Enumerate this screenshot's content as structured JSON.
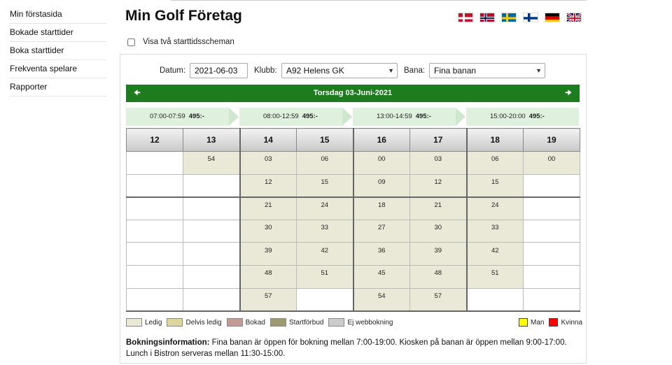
{
  "sidebar": {
    "items": [
      {
        "label": "Min förstasida"
      },
      {
        "label": "Bokade starttider"
      },
      {
        "label": "Boka starttider"
      },
      {
        "label": "Frekventa spelare"
      },
      {
        "label": "Rapporter"
      }
    ]
  },
  "header": {
    "title": "Min Golf Företag",
    "flags": [
      "danish-flag",
      "norwegian-flag",
      "swedish-flag",
      "finnish-flag",
      "german-flag",
      "uk-flag"
    ]
  },
  "options": {
    "show_two_schedules_label": "Visa två starttidsscheman",
    "show_two_schedules_checked": false
  },
  "filters": {
    "date_label": "Datum:",
    "date_value": "2021-06-03",
    "club_label": "Klubb:",
    "club_value": "A92 Helens GK",
    "course_label": "Bana:",
    "course_value": "Fina banan"
  },
  "daybar": {
    "prev_icon": "prev-arrow-icon",
    "date_text": "Torsdag 03-Juni-2021",
    "next_icon": "next-arrow-icon"
  },
  "time_tabs": [
    {
      "range": "07:00-07:59",
      "price": "495:-"
    },
    {
      "range": "08:00-12:59",
      "price": "495:-"
    },
    {
      "range": "13:00-14:59",
      "price": "495:-"
    },
    {
      "range": "15:00-20:00",
      "price": "495:-"
    }
  ],
  "grid": {
    "hours": [
      "12",
      "13",
      "14",
      "15",
      "16",
      "17",
      "18",
      "19"
    ],
    "rows": [
      [
        "",
        "54",
        "03",
        "06",
        "00",
        "03",
        "06",
        "00"
      ],
      [
        "",
        "",
        "12",
        "15",
        "09",
        "12",
        "15",
        ""
      ],
      [
        "",
        "",
        "21",
        "24",
        "18",
        "21",
        "24",
        ""
      ],
      [
        "",
        "",
        "30",
        "33",
        "27",
        "30",
        "33",
        ""
      ],
      [
        "",
        "",
        "39",
        "42",
        "36",
        "39",
        "42",
        ""
      ],
      [
        "",
        "",
        "48",
        "51",
        "45",
        "48",
        "51",
        ""
      ],
      [
        "",
        "",
        "57",
        "",
        "54",
        "57",
        "",
        ""
      ]
    ]
  },
  "legend": [
    {
      "label": "Ledig",
      "color": "#eae8d6"
    },
    {
      "label": "Delvis ledig",
      "color": "#dcd79a"
    },
    {
      "label": "Bokad",
      "color": "#c29a96"
    },
    {
      "label": "Startförbud",
      "color": "#9d9a72"
    },
    {
      "label": "Ej webbokning",
      "color": "#cccccc"
    }
  ],
  "gender_legend": [
    {
      "label": "Man",
      "color": "#ffff00"
    },
    {
      "label": "Kvinna",
      "color": "#ff0000"
    }
  ],
  "info": {
    "heading": "Bokningsinformation:",
    "text": " Fina banan är öppen för bokning mellan 7:00-19:00. Kiosken på banan är öppen mellan 9:00-17:00. Lunch i Bistron serveras mellan 11:30-15:00."
  }
}
